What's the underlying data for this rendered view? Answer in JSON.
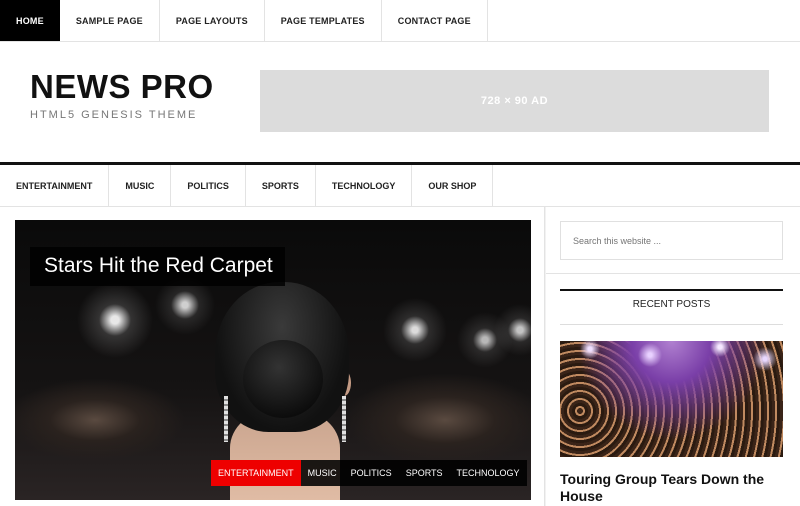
{
  "top_nav": {
    "items": [
      {
        "label": "HOME"
      },
      {
        "label": "SAMPLE PAGE"
      },
      {
        "label": "PAGE LAYOUTS"
      },
      {
        "label": "PAGE TEMPLATES"
      },
      {
        "label": "CONTACT PAGE"
      }
    ]
  },
  "header": {
    "site_title": "NEWS PRO",
    "site_description": "HTML5 GENESIS THEME",
    "ad_label": "728 × 90 AD"
  },
  "secondary_nav": {
    "items": [
      {
        "label": "ENTERTAINMENT"
      },
      {
        "label": "MUSIC"
      },
      {
        "label": "POLITICS"
      },
      {
        "label": "SPORTS"
      },
      {
        "label": "TECHNOLOGY"
      },
      {
        "label": "OUR SHOP"
      }
    ]
  },
  "slider": {
    "title": "Stars Hit the Red Carpet",
    "tags": [
      {
        "label": "ENTERTAINMENT"
      },
      {
        "label": "MUSIC"
      },
      {
        "label": "POLITICS"
      },
      {
        "label": "SPORTS"
      },
      {
        "label": "TECHNOLOGY"
      }
    ]
  },
  "sidebar": {
    "search_placeholder": "Search this website ...",
    "recent_posts_title": "RECENT POSTS",
    "recent_post_title": "Touring Group Tears Down the House"
  },
  "colors": {
    "active_nav_bg": "#000000",
    "active_tag_bg": "#ee0000",
    "ad_bg": "#dcdcdc"
  }
}
